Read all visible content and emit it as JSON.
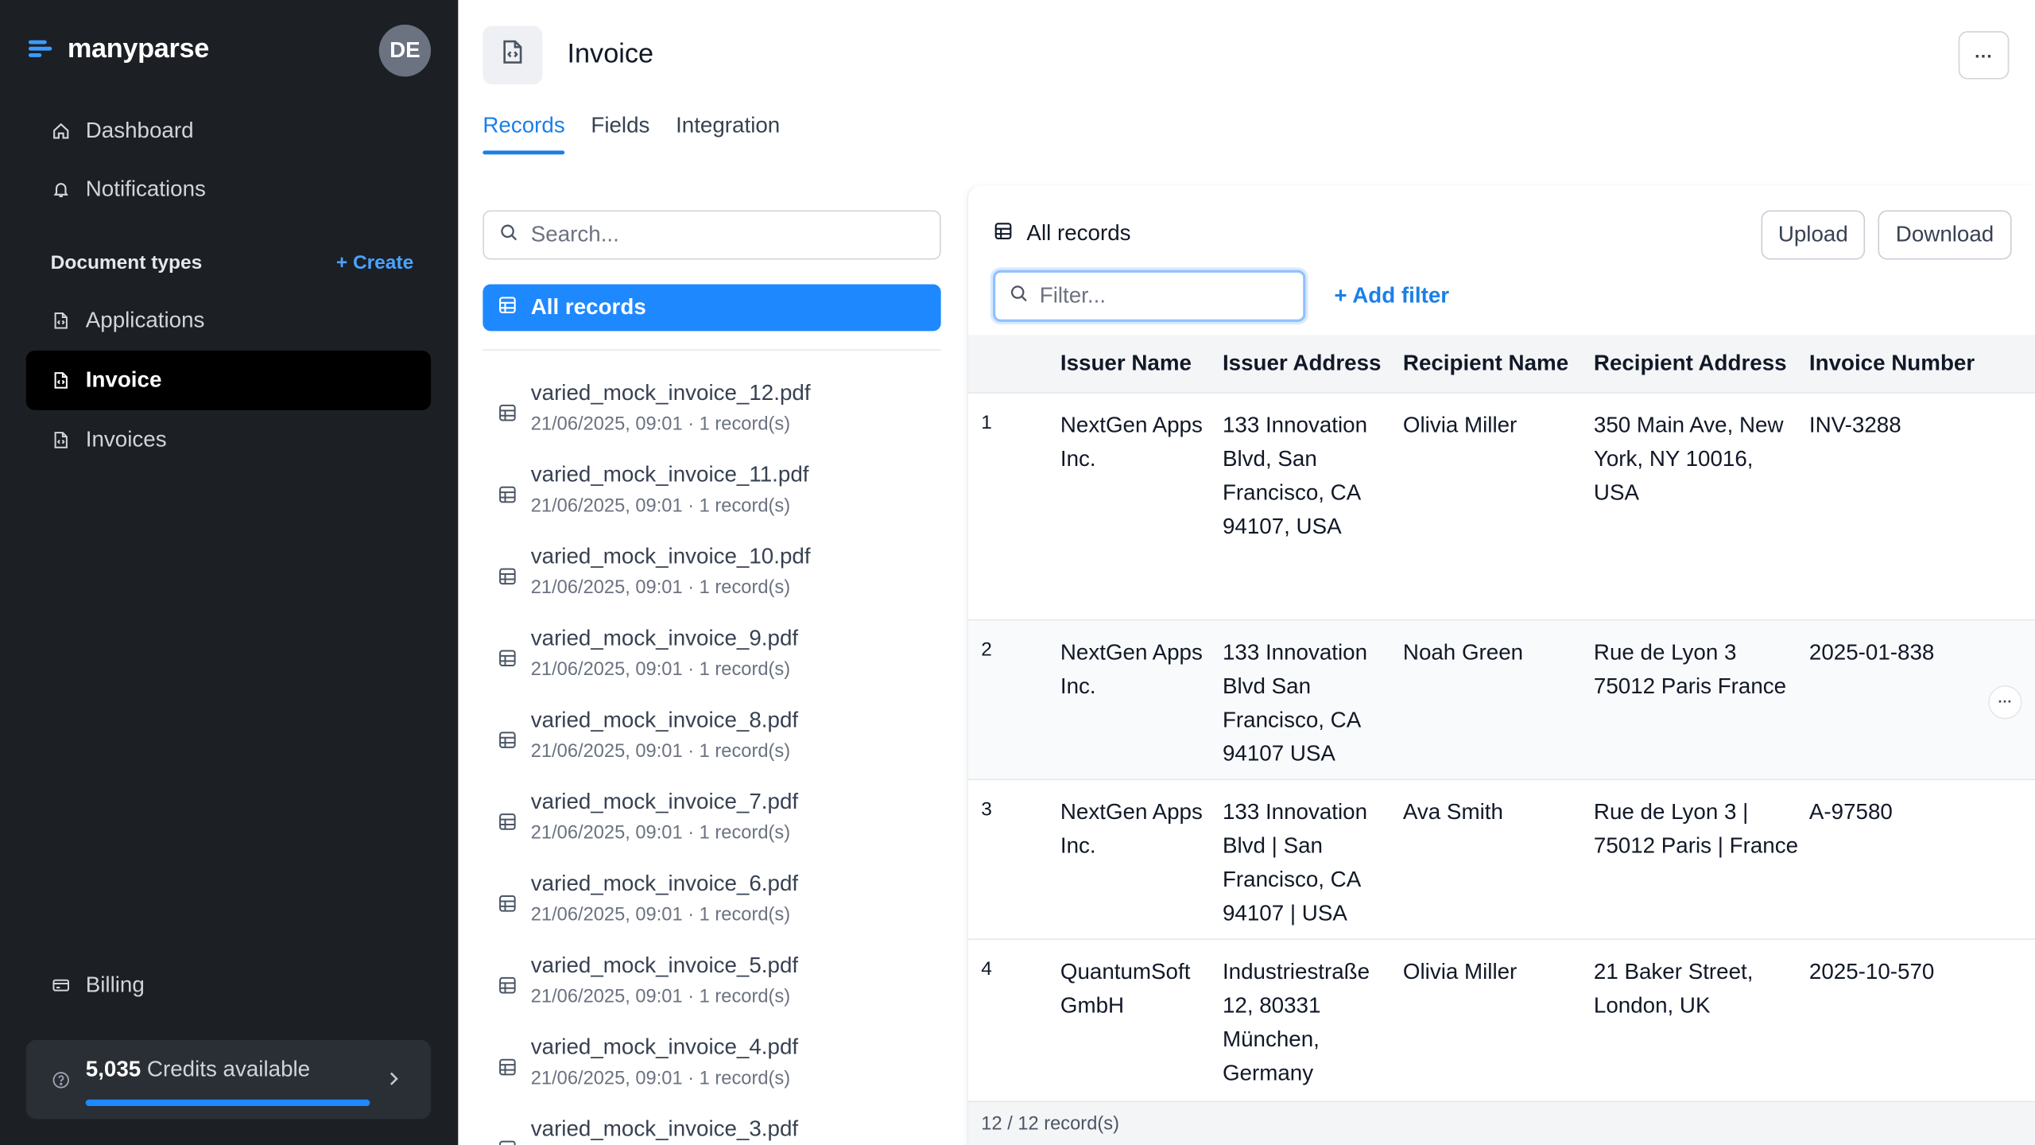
{
  "app": {
    "name": "manyparse",
    "avatar_initials": "DE"
  },
  "sidebar": {
    "nav": [
      {
        "label": "Dashboard",
        "icon": "home-icon"
      },
      {
        "label": "Notifications",
        "icon": "bell-icon"
      }
    ],
    "section_label": "Document types",
    "create_label": "+ Create",
    "doc_types": [
      {
        "label": "Applications",
        "icon": "file-code-icon",
        "active": false
      },
      {
        "label": "Invoice",
        "icon": "file-code-icon",
        "active": true
      },
      {
        "label": "Invoices",
        "icon": "file-code-icon",
        "active": false
      }
    ],
    "billing_label": "Billing",
    "credits": {
      "amount": "5,035",
      "suffix": " Credits available",
      "progress": 1.0
    }
  },
  "header": {
    "title": "Invoice",
    "more_label": "···",
    "tabs": [
      {
        "label": "Records",
        "active": true
      },
      {
        "label": "Fields",
        "active": false
      },
      {
        "label": "Integration",
        "active": false
      }
    ]
  },
  "file_list": {
    "search_placeholder": "Search...",
    "all_records_label": "All records",
    "files": [
      {
        "name": "varied_mock_invoice_12.pdf",
        "meta": "21/06/2025, 09:01 · 1 record(s)"
      },
      {
        "name": "varied_mock_invoice_11.pdf",
        "meta": "21/06/2025, 09:01 · 1 record(s)"
      },
      {
        "name": "varied_mock_invoice_10.pdf",
        "meta": "21/06/2025, 09:01 · 1 record(s)"
      },
      {
        "name": "varied_mock_invoice_9.pdf",
        "meta": "21/06/2025, 09:01 · 1 record(s)"
      },
      {
        "name": "varied_mock_invoice_8.pdf",
        "meta": "21/06/2025, 09:01 · 1 record(s)"
      },
      {
        "name": "varied_mock_invoice_7.pdf",
        "meta": "21/06/2025, 09:01 · 1 record(s)"
      },
      {
        "name": "varied_mock_invoice_6.pdf",
        "meta": "21/06/2025, 09:01 · 1 record(s)"
      },
      {
        "name": "varied_mock_invoice_5.pdf",
        "meta": "21/06/2025, 09:01 · 1 record(s)"
      },
      {
        "name": "varied_mock_invoice_4.pdf",
        "meta": "21/06/2025, 09:01 · 1 record(s)"
      },
      {
        "name": "varied_mock_invoice_3.pdf",
        "meta": ""
      }
    ]
  },
  "records": {
    "title": "All records",
    "upload_label": "Upload",
    "download_label": "Download",
    "filter_placeholder": "Filter...",
    "add_filter_label": "+ Add filter",
    "columns": [
      "Issuer Name",
      "Issuer Address",
      "Recipient Name",
      "Recipient Address",
      "Invoice Number"
    ],
    "rows": [
      {
        "num": "1",
        "issuer_name": "NextGen Apps Inc.",
        "issuer_address": "133 Innovation Blvd, San Francisco, CA 94107, USA",
        "recipient_name": "Olivia Miller",
        "recipient_address": "350 Main Ave, New York, NY 10016, USA",
        "invoice_number": "INV-3288"
      },
      {
        "num": "2",
        "issuer_name": "NextGen Apps Inc.",
        "issuer_address": "133 Innovation Blvd San Francisco, CA 94107 USA",
        "recipient_name": "Noah Green",
        "recipient_address": "Rue de Lyon 3 75012 Paris France",
        "invoice_number": "2025-01-838"
      },
      {
        "num": "3",
        "issuer_name": "NextGen Apps Inc.",
        "issuer_address": "133 Innovation Blvd | San Francisco, CA 94107 | USA",
        "recipient_name": "Ava Smith",
        "recipient_address": "Rue de Lyon 3 | 75012 Paris | France",
        "invoice_number": "A-97580"
      },
      {
        "num": "4",
        "issuer_name": "QuantumSoft GmbH",
        "issuer_address": "Industriestraße 12, 80331 München, Germany",
        "recipient_name": "Olivia Miller",
        "recipient_address": "21 Baker Street, London, UK",
        "invoice_number": "2025-10-570"
      }
    ],
    "row_more_label": "···",
    "footer": "12 / 12 record(s)"
  }
}
